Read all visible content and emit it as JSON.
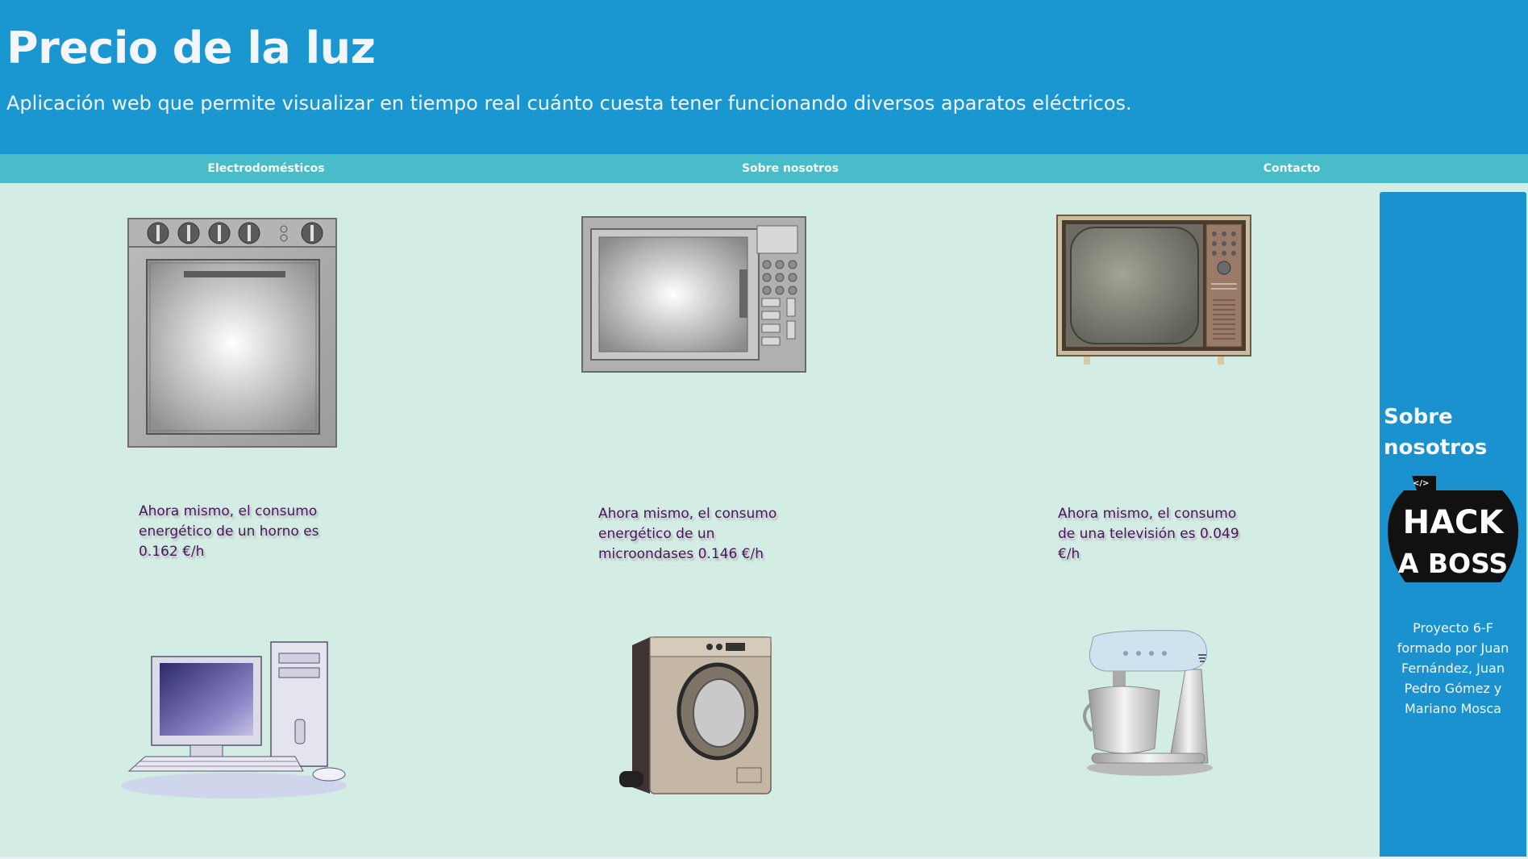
{
  "header": {
    "title": "Precio de la luz",
    "subtitle": "Aplicación web que permite visualizar en tiempo real cuánto cuesta tener funcionando diversos aparatos eléctricos."
  },
  "nav": {
    "items": [
      {
        "label": "Electrodomésticos"
      },
      {
        "label": "Sobre nosotros"
      },
      {
        "label": "Contacto"
      }
    ]
  },
  "appliances": [
    {
      "icon": "oven-icon",
      "caption": "Ahora mismo, el consumo energético de un horno es 0.162 €/h"
    },
    {
      "icon": "microwave-icon",
      "caption": "Ahora mismo, el consumo energético de un microondases 0.146 €/h"
    },
    {
      "icon": "television-icon",
      "caption": "Ahora mismo, el consumo de una televisión es 0.049 €/h"
    },
    {
      "icon": "computer-icon"
    },
    {
      "icon": "washing-machine-icon"
    },
    {
      "icon": "stand-mixer-icon"
    }
  ],
  "aside": {
    "title": "Sobre nosotros",
    "logo": {
      "icon": "hack-a-boss-logo",
      "text_top": "HACK",
      "text_bottom": "A BOSS",
      "tag": "</>"
    },
    "credits": "Proyecto 6-F formado por Juan Fernández, Juan Pedro Gómez y Mariano Mosca"
  },
  "colors": {
    "header_bg": "#1a97d0",
    "nav_bg": "#48bcc8",
    "page_bg": "#d4ede4",
    "aside_bg": "#1a92cf",
    "caption_text": "#4a1558"
  }
}
